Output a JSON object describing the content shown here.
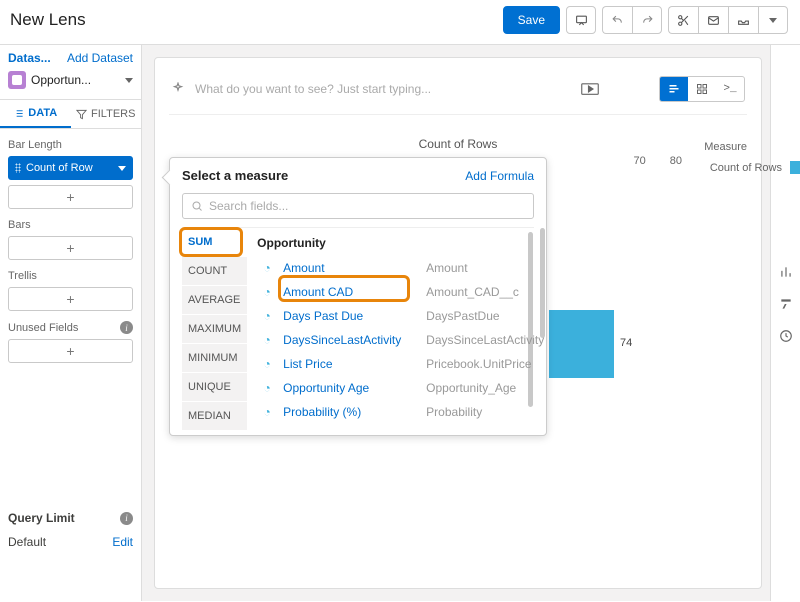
{
  "header": {
    "title": "New Lens",
    "save": "Save"
  },
  "sidebar": {
    "datasets_label": "Datas...",
    "add_dataset": "Add Dataset",
    "dataset_name": "Opportun...",
    "tabs": {
      "data": "DATA",
      "filters": "FILTERS"
    },
    "bar_length_label": "Bar Length",
    "bar_length_value": "Count of Row",
    "bars_label": "Bars",
    "trellis_label": "Trellis",
    "unused_label": "Unused Fields",
    "query_limit": "Query Limit",
    "default": "Default",
    "edit": "Edit",
    "plus": "+"
  },
  "canvas": {
    "query_placeholder": "What do you want to see? Just start typing...",
    "chart_title": "Count of Rows",
    "measure_label": "Measure",
    "legend_series": "Count of Rows",
    "ticks": {
      "t70": "70",
      "t80": "80"
    }
  },
  "chart_data": {
    "type": "bar",
    "orientation": "horizontal",
    "title": "Count of Rows",
    "xlabel": "Count of Rows",
    "ylabel": "",
    "series": [
      {
        "name": "Count of Rows",
        "values": [
          74
        ]
      }
    ],
    "categories": [
      ""
    ],
    "xlim": [
      0,
      80
    ]
  },
  "dd": {
    "title": "Select a measure",
    "add_formula": "Add Formula",
    "search_placeholder": "Search fields...",
    "aggs": [
      "SUM",
      "COUNT",
      "AVERAGE",
      "MAXIMUM",
      "MINIMUM",
      "UNIQUE",
      "MEDIAN"
    ],
    "group": "Opportunity",
    "fields": [
      {
        "label": "Amount",
        "api": "Amount"
      },
      {
        "label": "Amount CAD",
        "api": "Amount_CAD__c"
      },
      {
        "label": "Days Past Due",
        "api": "DaysPastDue"
      },
      {
        "label": "DaysSinceLastActivity",
        "api": "DaysSinceLastActivity"
      },
      {
        "label": "List Price",
        "api": "Pricebook.UnitPrice"
      },
      {
        "label": "Opportunity Age",
        "api": "Opportunity_Age"
      },
      {
        "label": "Probability (%)",
        "api": "Probability"
      }
    ]
  }
}
